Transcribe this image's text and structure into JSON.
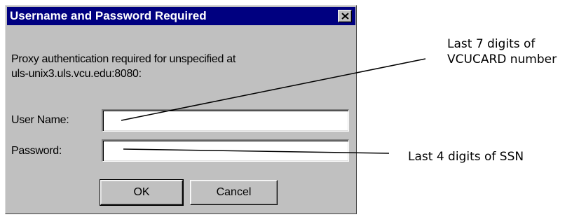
{
  "dialog": {
    "title": "Username and Password Required",
    "close_icon": "close-icon",
    "message_line1": "Proxy authentication required for unspecified at",
    "message_line2": "uls-unix3.uls.vcu.edu:8080:",
    "username": {
      "label": "User Name:",
      "value": ""
    },
    "password": {
      "label": "Password:",
      "value": ""
    },
    "ok_label": "OK",
    "cancel_label": "Cancel"
  },
  "annotations": {
    "username_note_line1": "Last 7 digits of",
    "username_note_line2": "VCUCARD number",
    "password_note": "Last 4 digits of SSN"
  },
  "colors": {
    "titlebar": "#000080",
    "dialog_face": "#c0c0c0",
    "title_text": "#ffffff"
  }
}
